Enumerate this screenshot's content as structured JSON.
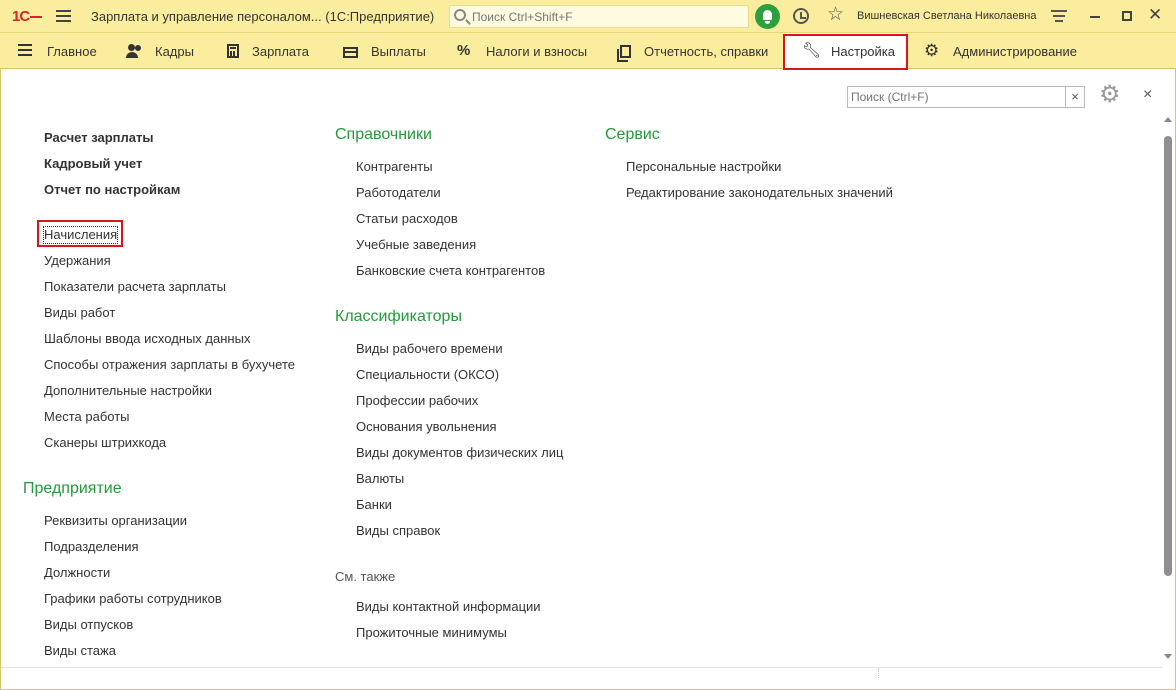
{
  "titlebar": {
    "logo": "1С",
    "app_title": "Зарплата и управление персоналом...  (1С:Предприятие)",
    "search_placeholder": "Поиск Ctrl+Shift+F",
    "user_name": "Вишневская Светлана Николаевна"
  },
  "sections": [
    {
      "label": "Главное",
      "icon": "menu-icon"
    },
    {
      "label": "Кадры",
      "icon": "people-icon"
    },
    {
      "label": "Зарплата",
      "icon": "calculator-icon"
    },
    {
      "label": "Выплаты",
      "icon": "wallet-icon"
    },
    {
      "label": "Налоги и взносы",
      "icon": "percent-icon"
    },
    {
      "label": "Отчетность, справки",
      "icon": "reports-icon"
    },
    {
      "label": "Настройка",
      "icon": "wrench-icon",
      "active": true
    },
    {
      "label": "Администрирование",
      "icon": "gear-icon"
    }
  ],
  "panel": {
    "search_placeholder": "Поиск (Ctrl+F)",
    "clear_label": "×",
    "close_label": "×"
  },
  "col1": {
    "bold_items": [
      "Расчет зарплаты",
      "Кадровый учет",
      "Отчет по настройкам"
    ],
    "items": [
      "Начисления",
      "Удержания",
      "Показатели расчета зарплаты",
      "Виды работ",
      "Шаблоны ввода исходных данных",
      "Способы отражения зарплаты в бухучете",
      "Дополнительные настройки",
      "Места работы",
      "Сканеры штрихкода"
    ],
    "enterprise_header": "Предприятие",
    "enterprise_items": [
      "Реквизиты организации",
      "Подразделения",
      "Должности",
      "Графики работы сотрудников",
      "Виды отпусков",
      "Виды стажа"
    ]
  },
  "col2": {
    "ref_header": "Справочники",
    "ref_items": [
      "Контрагенты",
      "Работодатели",
      "Статьи расходов",
      "Учебные заведения",
      "Банковские счета контрагентов"
    ],
    "class_header": "Классификаторы",
    "class_items": [
      "Виды рабочего времени",
      "Специальности (ОКСО)",
      "Профессии рабочих",
      "Основания увольнения",
      "Виды документов физических лиц",
      "Валюты",
      "Банки",
      "Виды справок"
    ],
    "see_also_header": "См. также",
    "see_also_items": [
      "Виды контактной информации",
      "Прожиточные минимумы"
    ]
  },
  "col3": {
    "service_header": "Сервис",
    "service_items": [
      "Персональные настройки",
      "Редактирование законодательных значений"
    ]
  },
  "colors": {
    "toolbar_bg": "#fbed9e",
    "header_green": "#229b3a",
    "highlight_red": "#d9151b",
    "notification_green": "#2e9f3e"
  }
}
